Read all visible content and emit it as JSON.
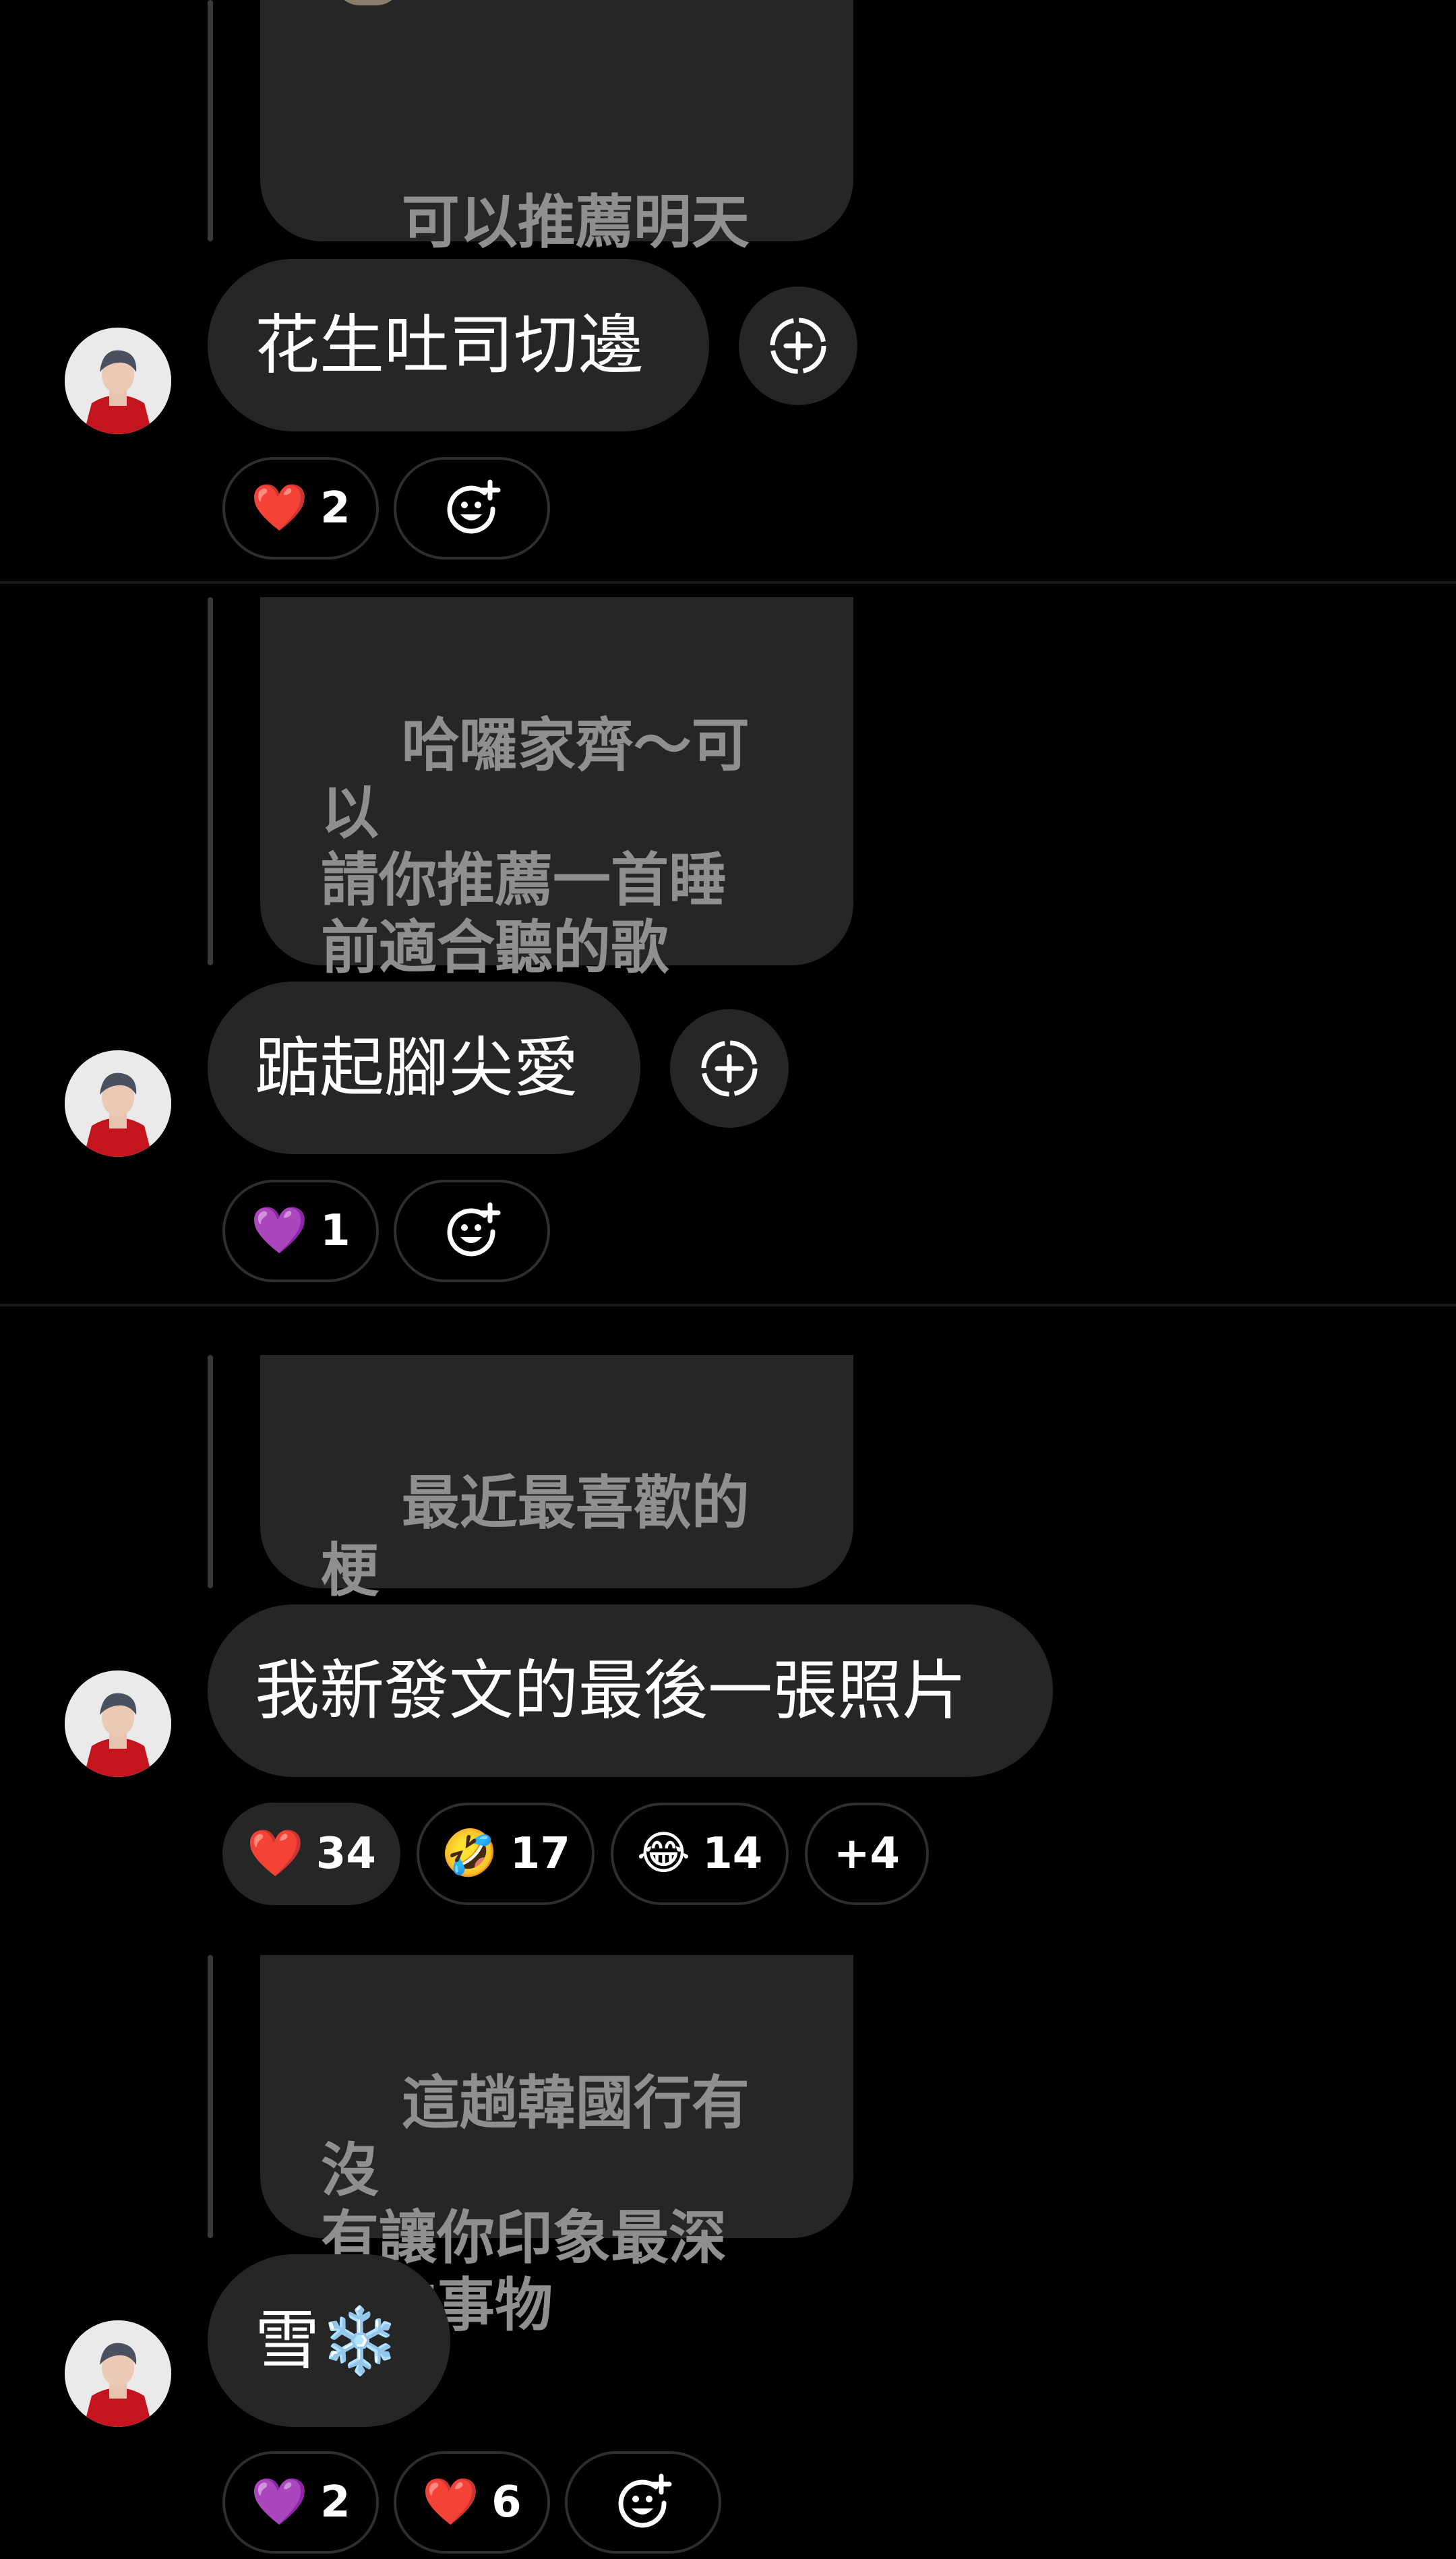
{
  "threads": [
    {
      "question": "可以推薦明天的\n早餐嗎？",
      "answer": "花生吐司切邊",
      "reactions": [
        {
          "emoji": "❤️",
          "count": "2"
        }
      ]
    },
    {
      "question": "哈囉家齊～可以\n請你推薦一首睡\n前適合聽的歌\n嗎？",
      "answer": "踮起腳尖愛",
      "reactions": [
        {
          "emoji": "💜",
          "count": "1"
        }
      ]
    },
    {
      "question": "最近最喜歡的梗\n圖是",
      "answer": "我新發文的最後一張照片",
      "reactions": [
        {
          "emoji": "❤️",
          "count": "34"
        },
        {
          "emoji": "🤣",
          "count": "17"
        },
        {
          "emoji": "😂",
          "count": "14"
        },
        {
          "emoji": "",
          "count": "+4"
        }
      ]
    },
    {
      "question": "這趟韓國行有沒\n有讓你印象最深\n刻的事物",
      "answer": "雪❄️",
      "reactions": [
        {
          "emoji": "💜",
          "count": "2"
        },
        {
          "emoji": "❤️",
          "count": "6"
        }
      ]
    }
  ],
  "icons": {
    "add_reply": "add-circle-dashed-icon",
    "add_reaction": "smiley-plus-icon",
    "question_emoji": "moon-face-icon"
  },
  "colors": {
    "background": "#000000",
    "bubble": "#262626",
    "quoted_text": "#8f8f8f",
    "heart_red": "#e0262d",
    "heart_purple": "#9b4dd6"
  }
}
